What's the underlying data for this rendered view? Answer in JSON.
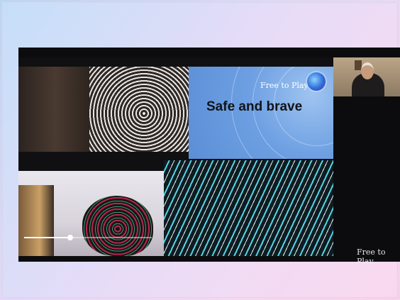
{
  "slide": {
    "title": "Safe and brave",
    "brand_top": "Free to Play",
    "playback": {
      "progress": 0.36
    }
  },
  "watermark": {
    "brand": "Free to Play"
  },
  "icons": {
    "globe": "globe-logo-icon",
    "presenter": "presenter-video"
  },
  "colors": {
    "background": "#b9d6f6",
    "stage": "#0c0c0e",
    "title_panel": "#6d9fe2"
  }
}
